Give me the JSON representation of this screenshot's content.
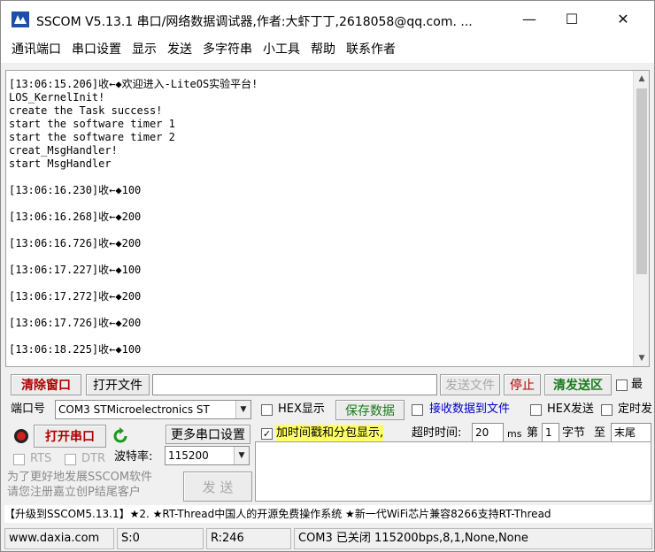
{
  "window": {
    "title": "SSCOM V5.13.1 串口/网络数据调试器,作者:大虾丁丁,2618058@qq.com. ...",
    "min_glyph": "—",
    "max_glyph": "☐",
    "close_glyph": "✕"
  },
  "menu": [
    "通讯端口",
    "串口设置",
    "显示",
    "发送",
    "多字符串",
    "小工具",
    "帮助",
    "联系作者"
  ],
  "receive": {
    "text": "[13:06:15.206]收←◆欢迎进入-LiteOS实验平台!\nLOS_KernelInit!\ncreate the Task success!\nstart the software timer 1\nstart the software timer 2\ncreat_MsgHandler!\nstart MsgHandler\n\n[13:06:16.230]收←◆100\n\n[13:06:16.268]收←◆200\n\n[13:06:16.726]收←◆200\n\n[13:06:17.227]收←◆100\n\n[13:06:17.272]收←◆200\n\n[13:06:17.726]收←◆200\n\n[13:06:18.225]收←◆100",
    "scroll_up": "▲",
    "scroll_down": "▼"
  },
  "toolbar": {
    "clear_window": "清除窗口",
    "open_file": "打开文件",
    "file_path": "",
    "send_file": "发送文件",
    "stop": "停止",
    "clear_send": "清发送区",
    "last_partial": "最"
  },
  "port": {
    "port_label": "端口号",
    "port_value": "COM3 STMicroelectronics ST",
    "hex_display": "HEX显示",
    "save_data": "保存数据",
    "recv_to_file": "接收数据到文件",
    "hex_send": "HEX发送",
    "timed_partial": "定时发",
    "open_port": "打开串口",
    "more_settings": "更多串口设置",
    "timestamp_split": "加时间戳和分包显示,",
    "timeout_label": "超时时间:",
    "timeout_value": "20",
    "ms": "ms",
    "nth": "第",
    "byte_index": "1",
    "byte_label": "字节",
    "to_label": "至",
    "end_value": "末尾",
    "rts": "RTS",
    "dtr": "DTR",
    "baud_label": "波特率:",
    "baud_value": "115200",
    "promo_line1": "为了更好地发展SSCOM软件",
    "promo_line2": "请您注册嘉立创P结尾客户",
    "send_button": "发  送",
    "send_text": ""
  },
  "marquee": "【升级到SSCOM5.13.1】★2. ★RT-Thread中国人的开源免费操作系统 ★新一代WiFi芯片兼容8266支持RT-Thread",
  "status": {
    "website": "www.daxia.com",
    "sent": "S:0",
    "received": "R:246",
    "port_state": "COM3 已关闭  115200bps,8,1,None,None"
  },
  "colors": {
    "accent_red": "#b00000",
    "accent_green": "#1a7a1a",
    "highlight_yellow": "#ffff66",
    "link_blue": "#0000cc"
  }
}
